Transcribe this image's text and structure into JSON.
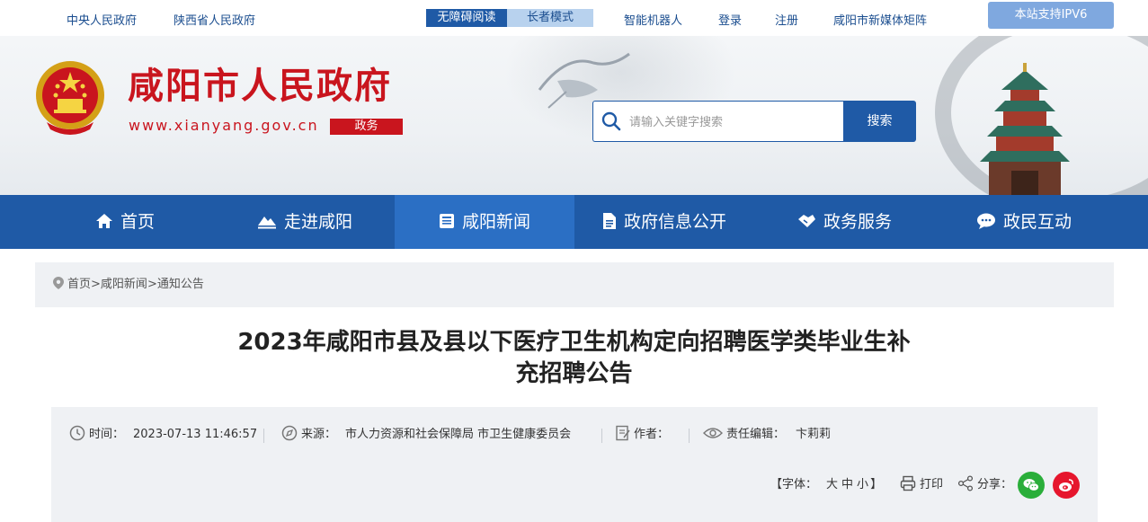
{
  "topbar": {
    "links": [
      "中央人民政府",
      "陕西省人民政府"
    ],
    "accessibility": "无障碍阅读",
    "elder_mode": "长者模式",
    "right_links": [
      "智能机器人",
      "登录",
      "注册",
      "咸阳市新媒体矩阵"
    ],
    "ipv6": "本站支持IPV6"
  },
  "header": {
    "title": "咸阳市人民政府",
    "url": "www.xianyang.gov.cn",
    "tag": "政务",
    "search_placeholder": "请输入关键字搜索",
    "search_button": "搜索"
  },
  "nav": {
    "items": [
      {
        "label": "首页",
        "icon": "home-icon"
      },
      {
        "label": "走进咸阳",
        "icon": "mountain-icon"
      },
      {
        "label": "咸阳新闻",
        "icon": "newspaper-icon"
      },
      {
        "label": "政府信息公开",
        "icon": "document-icon"
      },
      {
        "label": "政务服务",
        "icon": "handshake-icon"
      },
      {
        "label": "政民互动",
        "icon": "chat-icon"
      }
    ],
    "active_index": 2
  },
  "breadcrumb": {
    "items": [
      "首页",
      "咸阳新闻",
      "通知公告"
    ],
    "separator": ">"
  },
  "article": {
    "title_line1": "2023年咸阳市县及县以下医疗卫生机构定向招聘医学类毕业生补",
    "title_line2": "充招聘公告",
    "meta": {
      "time_label": "时间：",
      "time_value": "2023-07-13 11:46:57",
      "source_label": "来源：",
      "source_value": "市人力资源和社会保障局 市卫生健康委员会",
      "author_label": "作者：",
      "author_value": "",
      "editor_label": "责任编辑：",
      "editor_value": "卞莉莉"
    },
    "tools": {
      "font_open": "【字体：",
      "font_large": "大",
      "font_medium": "中",
      "font_small": "小",
      "font_close": "】",
      "print": "打印",
      "share": "分享："
    }
  },
  "colors": {
    "primary_blue": "#1f5aa6",
    "active_blue": "#2b6fc4",
    "brand_red": "#c9151e",
    "wechat_green": "#2aae3a",
    "weibo_red": "#e6162d"
  }
}
